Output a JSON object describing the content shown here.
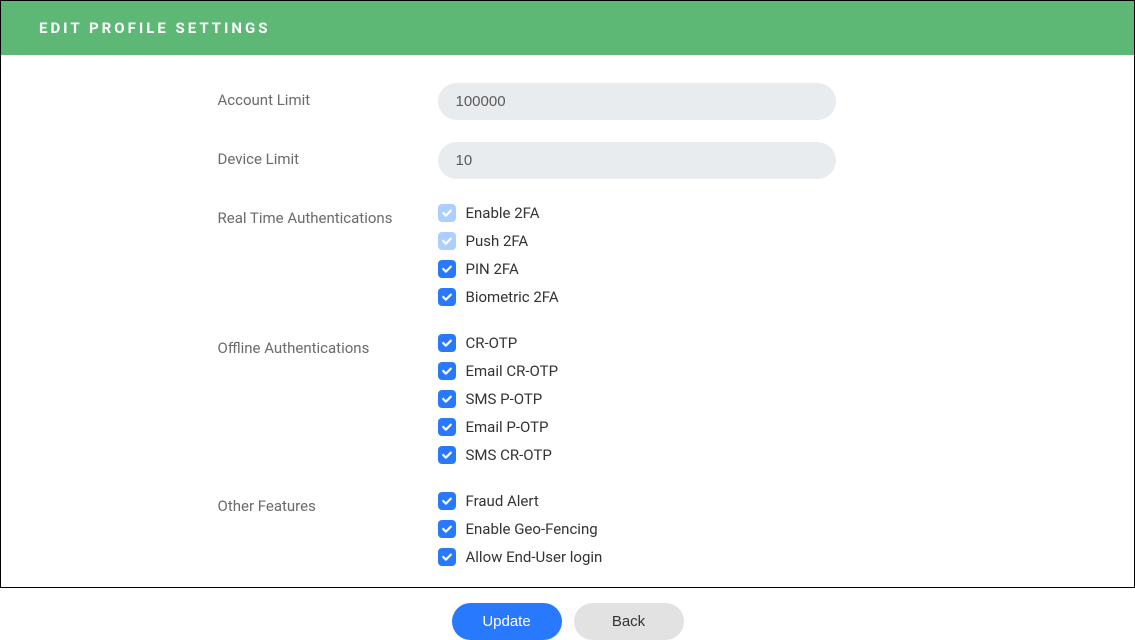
{
  "header": {
    "title": "EDIT PROFILE SETTINGS"
  },
  "form": {
    "account_limit": {
      "label": "Account Limit",
      "value": "100000"
    },
    "device_limit": {
      "label": "Device Limit",
      "value": "10"
    },
    "realtime_auth": {
      "label": "Real Time Authentications",
      "items": [
        {
          "label": "Enable 2FA",
          "checked": true,
          "disabled": true
        },
        {
          "label": "Push 2FA",
          "checked": true,
          "disabled": true
        },
        {
          "label": "PIN 2FA",
          "checked": true,
          "disabled": false
        },
        {
          "label": "Biometric 2FA",
          "checked": true,
          "disabled": false
        }
      ]
    },
    "offline_auth": {
      "label": "Offline Authentications",
      "items": [
        {
          "label": "CR-OTP",
          "checked": true,
          "disabled": false
        },
        {
          "label": "Email CR-OTP",
          "checked": true,
          "disabled": false
        },
        {
          "label": "SMS P-OTP",
          "checked": true,
          "disabled": false
        },
        {
          "label": "Email P-OTP",
          "checked": true,
          "disabled": false
        },
        {
          "label": "SMS CR-OTP",
          "checked": true,
          "disabled": false
        }
      ]
    },
    "other_features": {
      "label": "Other Features",
      "items": [
        {
          "label": "Fraud Alert",
          "checked": true,
          "disabled": false
        },
        {
          "label": "Enable Geo-Fencing",
          "checked": true,
          "disabled": false
        },
        {
          "label": "Allow End-User login",
          "checked": true,
          "disabled": false
        }
      ]
    }
  },
  "buttons": {
    "update": "Update",
    "back": "Back"
  }
}
